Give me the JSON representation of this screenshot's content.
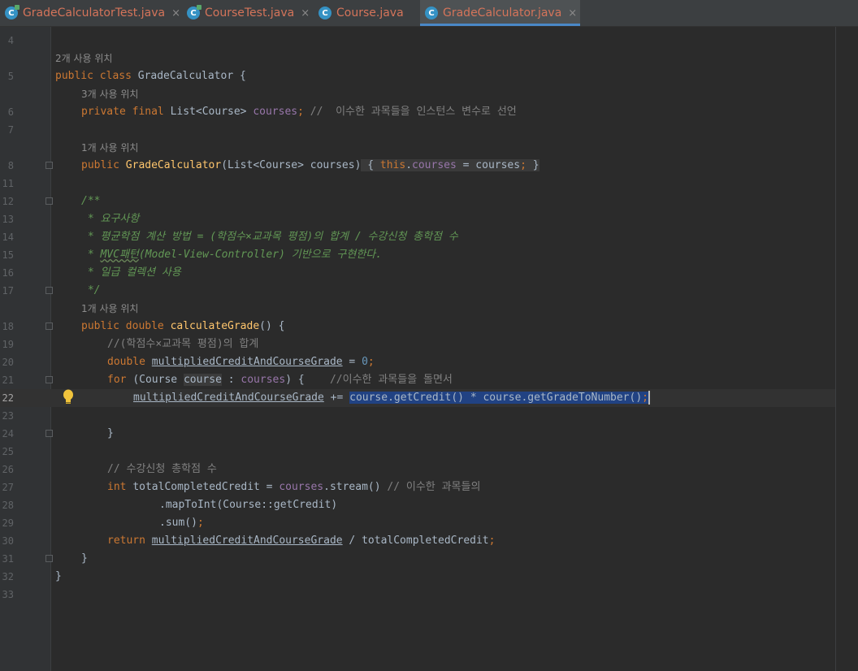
{
  "tabs": [
    {
      "label": "GradeCalculatorTest.java",
      "icon": "test-class-icon",
      "close": "×"
    },
    {
      "label": "CourseTest.java",
      "icon": "test-class-icon",
      "close": "×"
    },
    {
      "label": "Course.java",
      "icon": "class-icon",
      "close": ""
    },
    {
      "label": "GradeCalculator.java",
      "icon": "class-icon",
      "close": "×",
      "active": true
    }
  ],
  "icon_letter": "C",
  "usage_hints": {
    "class": "2개 사용 위치",
    "courses_field": "3개 사용 위치",
    "constructor": "1개 사용 위치",
    "calculate": "1개 사용 위치"
  },
  "line_numbers": [
    "4",
    "5",
    "6",
    "7",
    "8",
    "11",
    "12",
    "13",
    "14",
    "15",
    "16",
    "17",
    "18",
    "19",
    "20",
    "21",
    "22",
    "23",
    "24",
    "25",
    "26",
    "27",
    "28",
    "29",
    "30",
    "31",
    "32",
    "33"
  ],
  "code": {
    "l5": {
      "kw": "public class ",
      "name": "GradeCalculator {"
    },
    "l6": {
      "kw1": "private final ",
      "type": "List<Course> ",
      "field": "courses",
      "semi": ";",
      "comment": " //  이수한 과목들을 인스턴스 변수로 선언"
    },
    "l8": {
      "kw": "public ",
      "fn": "GradeCalculator",
      "params": "(List<Course> courses)",
      "b1": " { ",
      "this": "this",
      "dot": ".",
      "field": "courses",
      "rest": " = courses",
      "semi": ";",
      "b2": " }"
    },
    "l12": "/**",
    "l13": " * 요구사항",
    "l14": " * 평균학점 계산 방법 = (학점수×교과목 평점)의 합계 / 수강신청 총학점 수",
    "l15a": " * ",
    "l15b": "MVC패턴",
    "l15c": "(Model-View-Controller) 기반으로 구현한다.",
    "l16": " * 일급 컬렉션 사용",
    "l17": " */",
    "l18": {
      "kw": "public double ",
      "fn": "calculateGrade",
      "rest": "() {"
    },
    "l19": "//(학점수×교과목 평점)의 합계",
    "l20": {
      "kw": "double ",
      "var": "multipliedCreditAndCourseGrade",
      "eq": " = ",
      "num": "0",
      "semi": ";"
    },
    "l21": {
      "kw": "for ",
      "p1": "(Course ",
      "var": "course",
      "p2": " : ",
      "field": "courses",
      "p3": ") {",
      "comment": "    //이수한 과목들을 돌면서"
    },
    "l22": {
      "var": "multipliedCreditAndCourseGrade",
      "op": " += ",
      "sel": "course.getCredit() * course.getGradeToNumber()",
      "semi": ";"
    },
    "l24": "}",
    "l26": "// 수강신청 총학점 수",
    "l27": {
      "kw": "int ",
      "p1": "totalCompletedCredit = ",
      "field": "courses",
      "p2": ".stream() ",
      "comment": "// 이수한 과목들의"
    },
    "l28": ".mapToInt(Course::getCredit)",
    "l29": {
      "text": ".sum()",
      "semi": ";"
    },
    "l30": {
      "kw": "return ",
      "var": "multipliedCreditAndCourseGrade",
      "rest": " / totalCompletedCredit",
      "semi": ";"
    },
    "l31": "}",
    "l32": "}"
  },
  "colors": {
    "background": "#2b2b2b",
    "keyword": "#cc7832",
    "function": "#ffc66d",
    "field": "#9876aa",
    "number": "#6897bb",
    "comment": "#808080",
    "doc_comment": "#629755",
    "selection": "#214283",
    "tab_text": "#d4745a"
  }
}
